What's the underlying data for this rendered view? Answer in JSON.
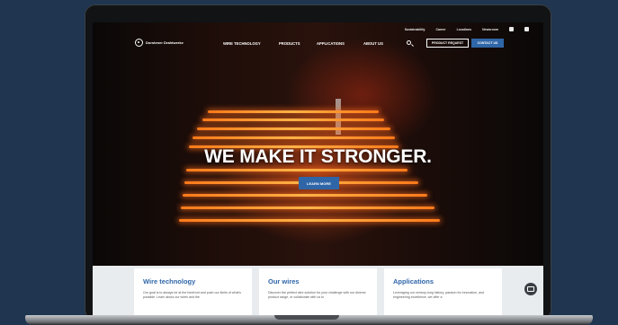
{
  "site": {
    "logo_text": "Dorstener Drahtwerke"
  },
  "utility_nav": [
    "Sustainability",
    "Career",
    "Locations",
    "Newsroom"
  ],
  "social_icons": [
    "linkedin-icon",
    "instagram-icon"
  ],
  "main_nav": [
    "WIRE TECHNOLOGY",
    "PRODUCTS",
    "APPLICATIONS",
    "ABOUT US"
  ],
  "header_buttons": {
    "request": "PRODUCT REQUEST",
    "contact": "CONTACT US"
  },
  "hero": {
    "title": "WE MAKE IT STRONGER.",
    "cta": "LEARN MORE"
  },
  "cards": [
    {
      "title": "Wire technology",
      "text": "Our goal is to always be at the forefront and push our limits of what's possible. Learn about our wires and the"
    },
    {
      "title": "Our wires",
      "text": "Discover the perfect wire solution for your challenge with our diverse product range, or collaborate with us to"
    },
    {
      "title": "Applications",
      "text": "Leveraging our century-long history, passion for innovation, and engineering excellence, we offer a"
    }
  ],
  "colors": {
    "brand_blue": "#2f66a8",
    "background": "#1f3550",
    "glow": "#ff7a1a"
  }
}
